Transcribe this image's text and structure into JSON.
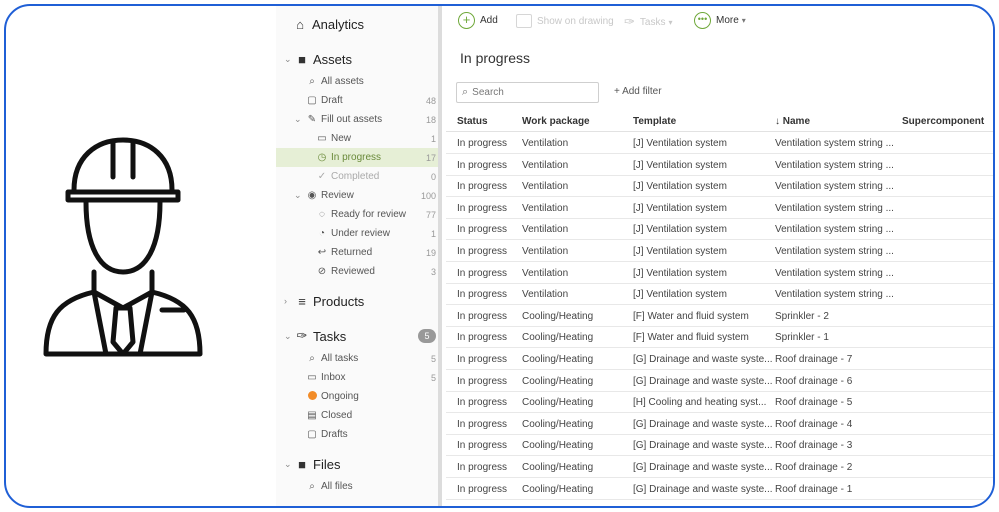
{
  "sidebar": {
    "analytics": "Analytics",
    "assets": "Assets",
    "all_assets": "All assets",
    "draft": {
      "label": "Draft",
      "count": "48"
    },
    "fill_out_assets": {
      "label": "Fill out assets",
      "count": "18"
    },
    "new": {
      "label": "New",
      "count": "1"
    },
    "in_progress": {
      "label": "In progress",
      "count": "17"
    },
    "completed": {
      "label": "Completed",
      "count": "0"
    },
    "review": {
      "label": "Review",
      "count": "100"
    },
    "ready_for_review": {
      "label": "Ready for review",
      "count": "77"
    },
    "under_review": {
      "label": "Under review",
      "count": "1"
    },
    "returned": {
      "label": "Returned",
      "count": "19"
    },
    "reviewed": {
      "label": "Reviewed",
      "count": "3"
    },
    "products": "Products",
    "tasks": {
      "label": "Tasks",
      "count": "5"
    },
    "all_tasks": {
      "label": "All tasks",
      "count": "5"
    },
    "inbox": {
      "label": "Inbox",
      "count": "5"
    },
    "ongoing": "Ongoing",
    "closed": "Closed",
    "drafts": "Drafts",
    "files": "Files",
    "all_files": "All files"
  },
  "toolbar": {
    "add": "Add",
    "show_on_drawing": "Show on drawing",
    "tasks": "Tasks",
    "more": "More"
  },
  "main": {
    "title": "In progress",
    "search_placeholder": "Search",
    "add_filter": "+ Add filter"
  },
  "table": {
    "headers": {
      "status": "Status",
      "work_package": "Work package",
      "template": "Template",
      "name": "↓  Name",
      "supercomponent": "Supercomponent"
    },
    "rows": [
      [
        "In progress",
        "Ventilation",
        "[J] Ventilation system",
        "Ventilation system string ..."
      ],
      [
        "In progress",
        "Ventilation",
        "[J] Ventilation system",
        "Ventilation system string ..."
      ],
      [
        "In progress",
        "Ventilation",
        "[J] Ventilation system",
        "Ventilation system string ..."
      ],
      [
        "In progress",
        "Ventilation",
        "[J] Ventilation system",
        "Ventilation system string ..."
      ],
      [
        "In progress",
        "Ventilation",
        "[J] Ventilation system",
        "Ventilation system string ..."
      ],
      [
        "In progress",
        "Ventilation",
        "[J] Ventilation system",
        "Ventilation system string ..."
      ],
      [
        "In progress",
        "Ventilation",
        "[J] Ventilation system",
        "Ventilation system string ..."
      ],
      [
        "In progress",
        "Ventilation",
        "[J] Ventilation system",
        "Ventilation system string ..."
      ],
      [
        "In progress",
        "Cooling/Heating",
        "[F] Water and fluid system",
        "Sprinkler - 2"
      ],
      [
        "In progress",
        "Cooling/Heating",
        "[F] Water and fluid system",
        "Sprinkler - 1"
      ],
      [
        "In progress",
        "Cooling/Heating",
        "[G] Drainage and waste syste...",
        "Roof drainage - 7"
      ],
      [
        "In progress",
        "Cooling/Heating",
        "[G] Drainage and waste syste...",
        "Roof drainage - 6"
      ],
      [
        "In progress",
        "Cooling/Heating",
        "[H] Cooling and heating syst...",
        "Roof drainage - 5"
      ],
      [
        "In progress",
        "Cooling/Heating",
        "[G] Drainage and waste syste...",
        "Roof drainage - 4"
      ],
      [
        "In progress",
        "Cooling/Heating",
        "[G] Drainage and waste syste...",
        "Roof drainage - 3"
      ],
      [
        "In progress",
        "Cooling/Heating",
        "[G] Drainage and waste syste...",
        "Roof drainage - 2"
      ],
      [
        "In progress",
        "Cooling/Heating",
        "[G] Drainage and waste syste...",
        "Roof drainage - 1"
      ]
    ]
  },
  "colors": {
    "frame_border": "#1f5fd6",
    "accent_green": "#6fa83a",
    "selected_bg": "#e6efd6",
    "ongoing_dot": "#f28c28"
  }
}
